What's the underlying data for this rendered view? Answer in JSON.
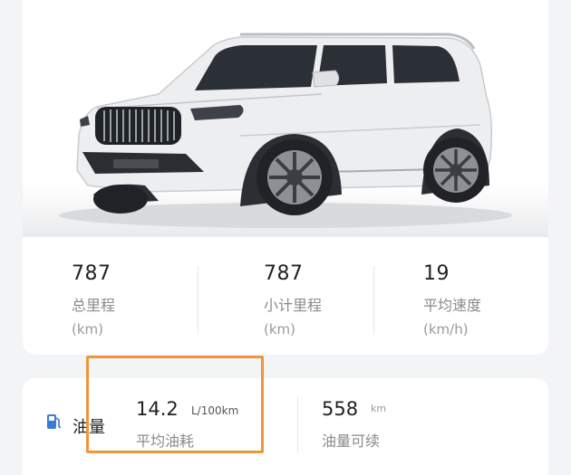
{
  "vehicle_image": {
    "icon": "white-suv-image"
  },
  "stats": [
    {
      "value": "787",
      "label": "总里程",
      "unit": "(km)"
    },
    {
      "value": "787",
      "label": "小计里程",
      "unit": "(km)"
    },
    {
      "value": "19",
      "label": "平均速度",
      "unit": "(km/h)"
    }
  ],
  "fuel": {
    "icon": "fuel-pump-icon",
    "title": "油量",
    "avg_consumption": {
      "value": "14.2",
      "unit": "L/100km",
      "label": "平均油耗"
    },
    "range": {
      "value": "558",
      "unit": "km",
      "label": "油量可续"
    }
  },
  "highlight_color": "#f0953b"
}
